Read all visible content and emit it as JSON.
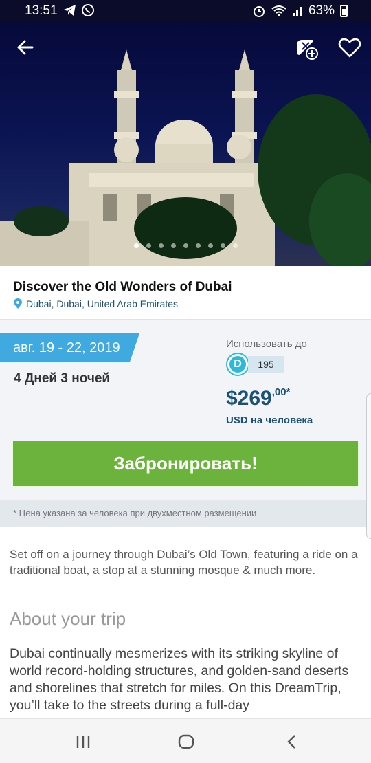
{
  "status_bar": {
    "time": "13:51",
    "battery": "63%",
    "battery_level": 0.63
  },
  "hero": {
    "icons": {
      "back": "arrow-left-icon",
      "compare": "compare-add-icon",
      "favorite": "heart-outline-icon"
    },
    "carousel": {
      "total": 9,
      "active_index": 0
    }
  },
  "trip": {
    "title": "Discover the Old Wonders of Dubai",
    "location": "Dubai, Dubai, United Arab Emirates"
  },
  "booking": {
    "dates": "авг. 19 - 22, 2019",
    "duration": "4 Дней 3 ночей",
    "use_until_label": "Использовать до",
    "dt_coin_label": "D",
    "dt_amount": "195",
    "price_main": "$269",
    "price_cents": ",00*",
    "price_unit": "USD на человека",
    "book_label": "Забронировать!"
  },
  "note": "* Цена указана за человека при двухместном размещении",
  "description": {
    "lead": "Set off on a journey through Dubai’s Old Town, featuring a ride on a traditional boat, a stop at a stunning mosque & much more.",
    "heading": "About your trip",
    "body": "Dubai continually mesmerizes with its striking skyline of world record-holding structures, and golden-sand deserts and shorelines that stretch for miles. On this DreamTrip, you’ll take to the streets during a full-day"
  },
  "colors": {
    "accent": "#3fa9e0",
    "book": "#6cb33e",
    "price": "#1a5276"
  }
}
